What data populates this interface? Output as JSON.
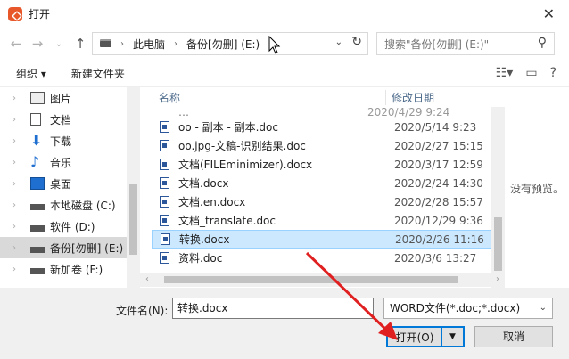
{
  "window": {
    "title": "打开",
    "close": "✕"
  },
  "nav": {
    "back": "←",
    "forward": "→",
    "recent": "⌄",
    "up": "↑"
  },
  "address": {
    "crumbs": [
      "此电脑",
      "备份[勿删] (E:)"
    ],
    "sep": "›"
  },
  "search": {
    "placeholder": "搜索\"备份[勿删] (E:)\""
  },
  "toolbar": {
    "organize": "组织 ▾",
    "new_folder": "新建文件夹"
  },
  "sidebar": {
    "items": [
      {
        "label": "图片",
        "icon": "pictures-icon"
      },
      {
        "label": "文档",
        "icon": "documents-icon"
      },
      {
        "label": "下载",
        "icon": "downloads-icon"
      },
      {
        "label": "音乐",
        "icon": "music-icon"
      },
      {
        "label": "桌面",
        "icon": "desktop-icon"
      },
      {
        "label": "本地磁盘 (C:)",
        "icon": "drive-icon"
      },
      {
        "label": "软件 (D:)",
        "icon": "drive-icon"
      },
      {
        "label": "备份[勿删] (E:)",
        "icon": "drive-icon"
      },
      {
        "label": "新加卷 (F:)",
        "icon": "drive-icon"
      }
    ]
  },
  "columns": {
    "name": "名称",
    "date": "修改日期"
  },
  "partial_row": {
    "name": "…",
    "date": "2020/4/29 9:24"
  },
  "files": [
    {
      "name": "oo - 副本 - 副本.doc",
      "date": "2020/5/14 9:23"
    },
    {
      "name": "oo.jpg-文稿-识别结果.doc",
      "date": "2020/2/27 15:15"
    },
    {
      "name": "文档(FILEminimizer).docx",
      "date": "2020/3/17 12:59"
    },
    {
      "name": "文档.docx",
      "date": "2020/2/24 14:30"
    },
    {
      "name": "文档.en.docx",
      "date": "2020/2/28 15:57"
    },
    {
      "name": "文档_translate.doc",
      "date": "2020/12/29 9:36"
    },
    {
      "name": "转换.docx",
      "date": "2020/2/26 11:16",
      "selected": true
    },
    {
      "name": "资料.doc",
      "date": "2020/3/6 13:27"
    }
  ],
  "preview": {
    "text": "没有预览。"
  },
  "filename": {
    "label": "文件名(N):",
    "value": "转换.docx"
  },
  "filetype": {
    "value": "WORD文件(*.doc;*.docx)"
  },
  "buttons": {
    "open": "打开(O)",
    "cancel": "取消"
  },
  "colors": {
    "accent": "#0078d7",
    "selection": "#cce8ff",
    "annotation": "#e02020"
  }
}
